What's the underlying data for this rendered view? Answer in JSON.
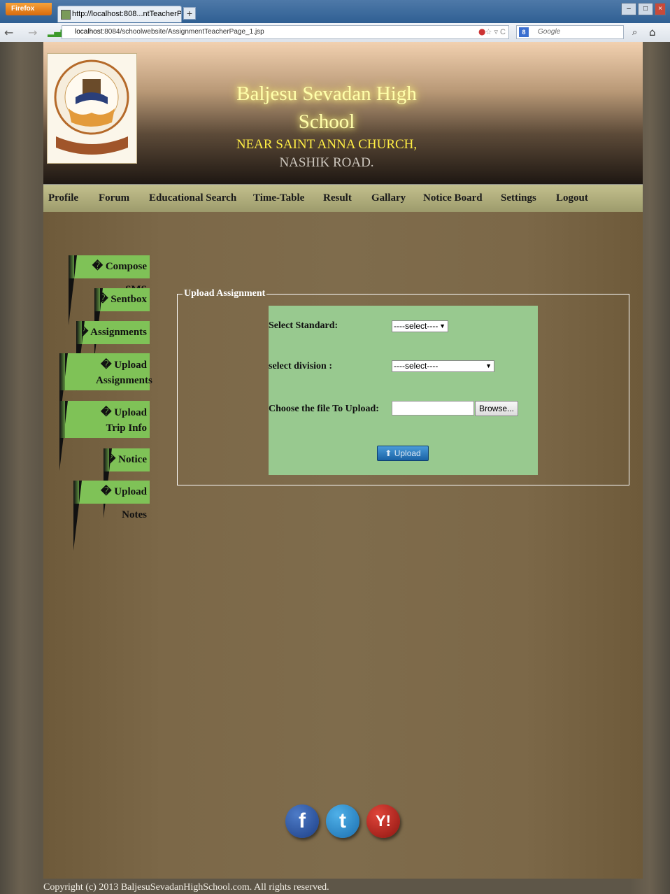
{
  "browser": {
    "app_button": "Firefox",
    "tab_title": "http://localhost:808...ntTeacherPage_1.jsp",
    "new_tab": "+",
    "url_host": "localhost",
    "url_rest": ":8084/schoolwebsite/AssignmentTeacherPage_1.jsp",
    "search_placeholder": "Google"
  },
  "header": {
    "title": "Baljesu Sevadan High School",
    "subtitle_highlight": "NEAR SAINT ANNA CHURCH,",
    "subtitle_rest": " NASHIK ROAD."
  },
  "menu": [
    "Profile",
    "Forum",
    "Educational Search",
    "Time-Table",
    "Result",
    "Gallary",
    "Notice Board",
    "Settings",
    "Logout"
  ],
  "sidebar": [
    "� Compose SMS",
    "� Sentbox",
    "� Assignments",
    "� Upload Assignments",
    "� Upload Trip Info",
    "� Notice",
    "� Upload Notes"
  ],
  "form": {
    "legend": "Upload Assignment",
    "standard_label": "Select Standard:",
    "standard_value": "----select----",
    "division_label": "select division :",
    "division_value": "----select----",
    "file_label": "Choose the file To Upload:",
    "browse_label": "Browse...",
    "upload_label": "Upload"
  },
  "social": {
    "facebook": "f",
    "twitter": "t",
    "yahoo": "Y!"
  },
  "footer": "Copyright (c) 2013 BaljesuSevadanHighSchool.com. All rights reserved.",
  "colors": {
    "menu_bar": "#b3b07e",
    "side_button": "#7fc257",
    "form_panel": "#98c98f",
    "title_glow": "#ffffaa"
  }
}
